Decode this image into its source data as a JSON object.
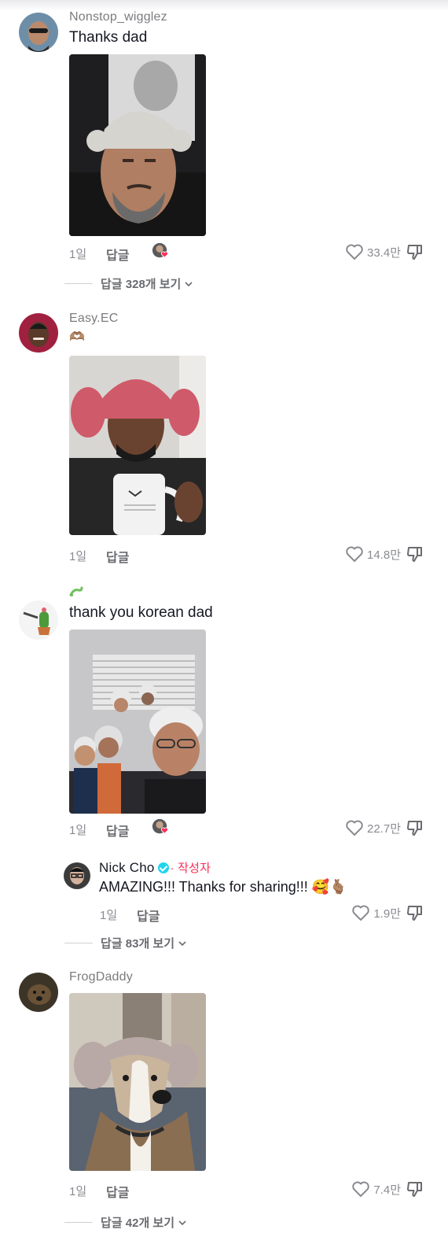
{
  "comments": [
    {
      "username": "Nonstop_wigglez",
      "text": "Thanks dad",
      "time": "1일",
      "reply_label": "답글",
      "likes": "33.4만",
      "view_replies": "답글 328개 보기"
    },
    {
      "username": "Easy.EC",
      "text": "🫶🏽",
      "time": "1일",
      "reply_label": "답글",
      "likes": "14.8만"
    },
    {
      "username": "",
      "text": "thank you korean dad",
      "time": "1일",
      "reply_label": "답글",
      "likes": "22.7만",
      "reply": {
        "username": "Nick Cho",
        "author_tag": "· 작성자",
        "text": "AMAZING!!! Thanks for sharing!!! 🥰🫰🏽",
        "time": "1일",
        "reply_label": "답글",
        "likes": "1.9만"
      },
      "view_replies": "답글 83개 보기"
    },
    {
      "username": "FrogDaddy",
      "text": "",
      "time": "1일",
      "reply_label": "답글",
      "likes": "7.4만",
      "view_replies": "답글 42개 보기"
    }
  ],
  "icons": {
    "heart": "heart-outline-icon",
    "dislike": "thumbs-down-icon",
    "chevron": "chevron-down-icon",
    "creator_liked": "creator-liked-avatar-icon",
    "verified": "verified-badge-icon"
  },
  "colors": {
    "username": "#7c7c80",
    "meta": "#8a8b91",
    "verified": "#20d5ec",
    "author_tag": "#fe2c55",
    "heart_badge": "#fe2c55"
  }
}
